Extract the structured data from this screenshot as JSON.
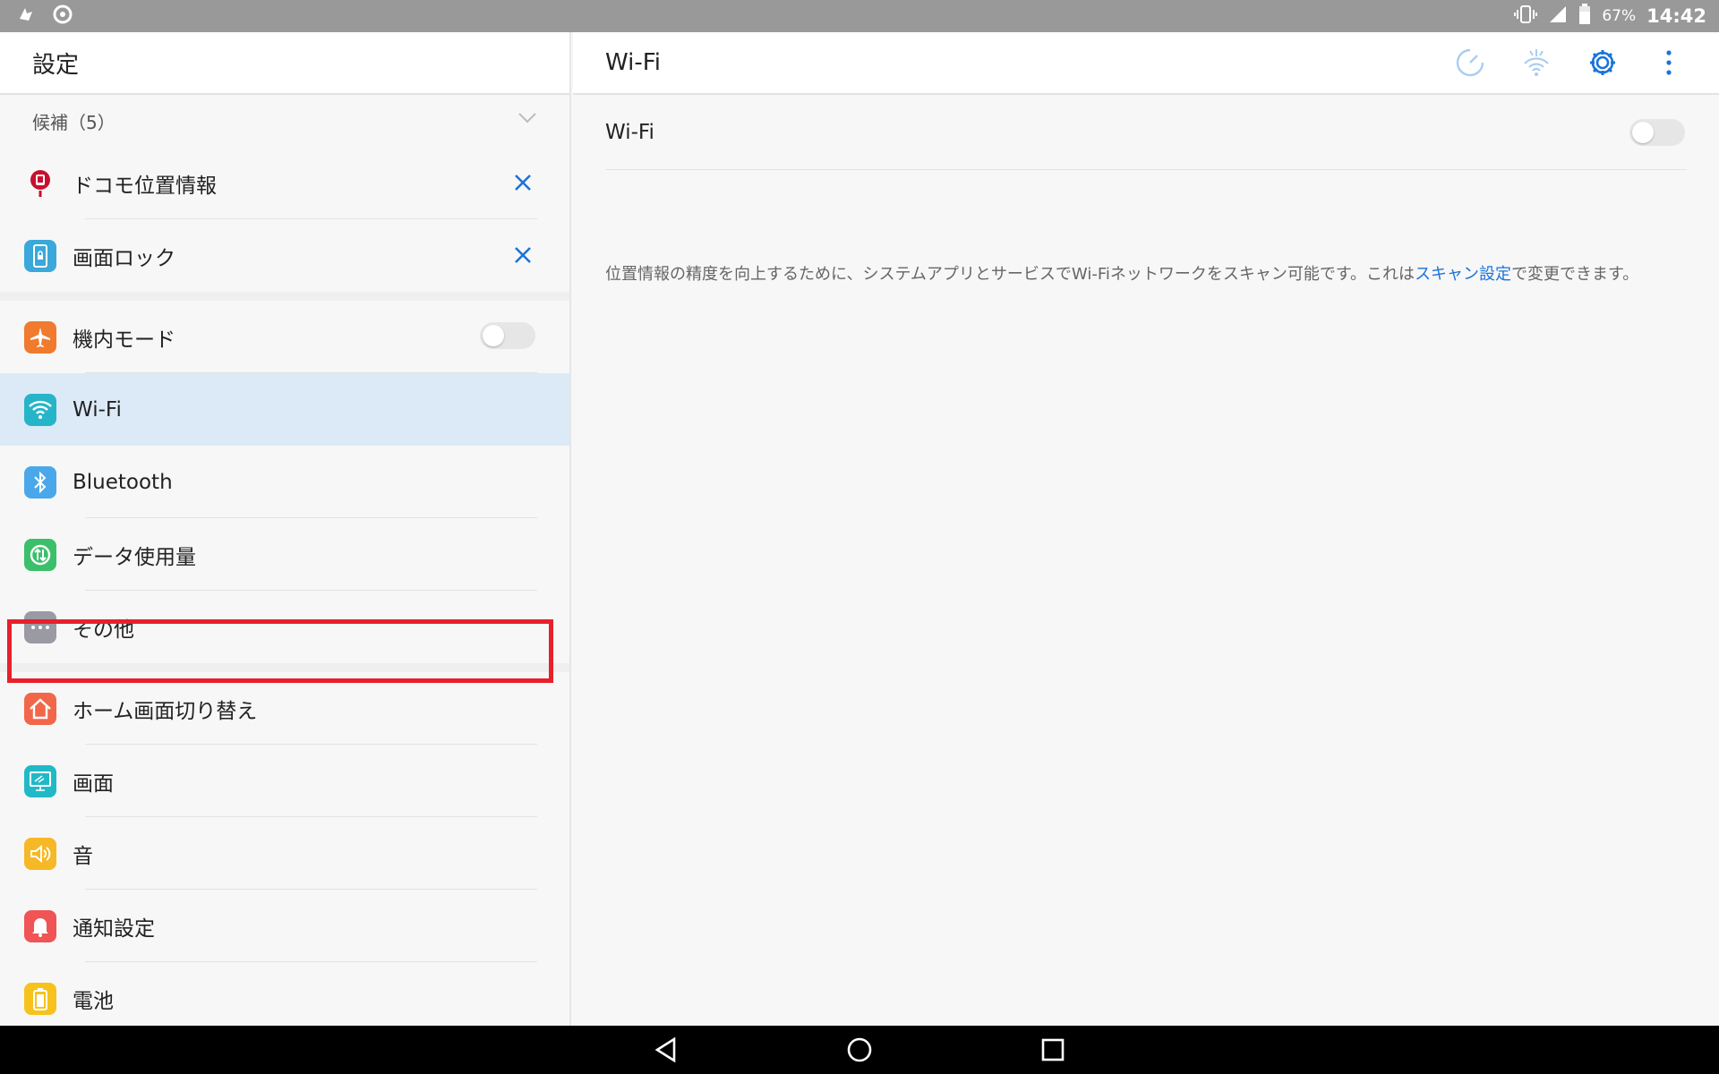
{
  "status_bar": {
    "battery_percent": "67%",
    "time": "14:42"
  },
  "left_pane": {
    "title": "設定",
    "suggestions_header": "候補（5）",
    "suggestions": [
      {
        "label": "ドコモ位置情報",
        "icon": "docomo-location-icon",
        "color": "#c8102e"
      },
      {
        "label": "画面ロック",
        "icon": "screen-lock-icon",
        "color": "#3aa8d8"
      }
    ],
    "group1": [
      {
        "label": "機内モード",
        "icon": "airplane-icon",
        "color": "#f07a2e",
        "toggle": "off"
      },
      {
        "label": "Wi-Fi",
        "icon": "wifi-icon",
        "color": "#26b5c8",
        "selected": true
      },
      {
        "label": "Bluetooth",
        "icon": "bluetooth-icon",
        "color": "#4aa8ea"
      },
      {
        "label": "データ使用量",
        "icon": "data-usage-icon",
        "color": "#3cbf6a"
      },
      {
        "label": "その他",
        "icon": "more-icon",
        "color": "#9a9aa4"
      }
    ],
    "group2": [
      {
        "label": "ホーム画面切り替え",
        "icon": "home-icon",
        "color": "#f2674a"
      },
      {
        "label": "画面",
        "icon": "display-icon",
        "color": "#22b9c6"
      },
      {
        "label": "音",
        "icon": "sound-icon",
        "color": "#f6b826"
      },
      {
        "label": "通知設定",
        "icon": "notification-icon",
        "color": "#f05454"
      },
      {
        "label": "電池",
        "icon": "battery-icon",
        "color": "#f6c21c"
      }
    ]
  },
  "right_pane": {
    "title": "Wi-Fi",
    "wifi_label": "Wi-Fi",
    "wifi_toggle": "off",
    "info_text_before": "位置情報の精度を向上するために、システムアプリとサービスでWi-Fiネットワークをスキャン可能です。これは",
    "info_link": "スキャン設定",
    "info_text_after": "で変更できます。",
    "accent_color": "#1a73d9"
  }
}
